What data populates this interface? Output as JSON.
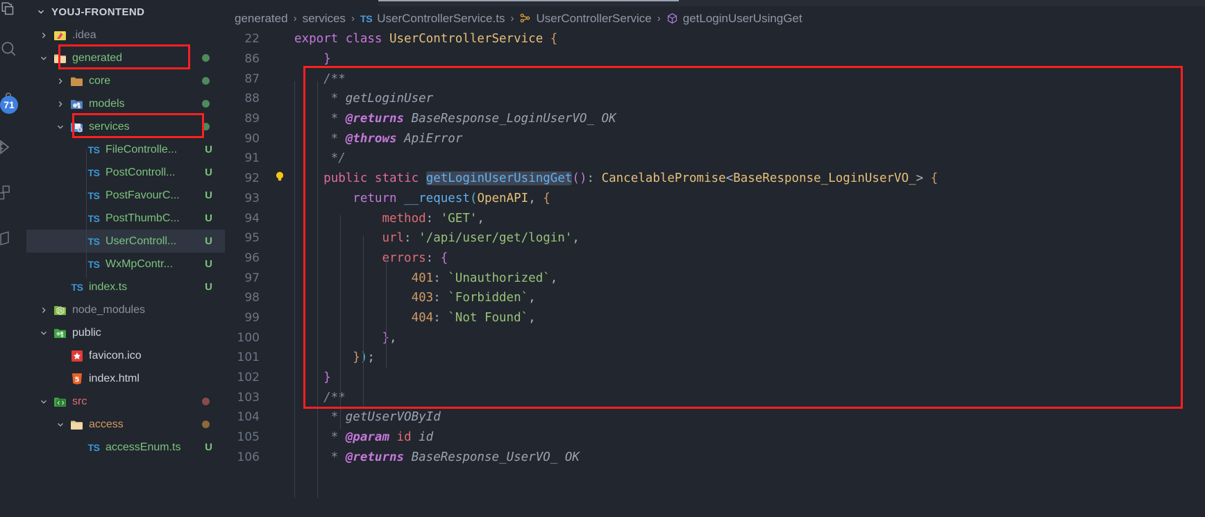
{
  "activity_bar": {
    "items": [
      {
        "name": "explorer-icon",
        "glyph": "files"
      },
      {
        "name": "search-icon",
        "glyph": "search"
      },
      {
        "name": "source-control-icon",
        "glyph": "branch"
      },
      {
        "name": "run-debug-icon",
        "glyph": "play"
      },
      {
        "name": "extensions-icon",
        "glyph": "squares"
      },
      {
        "name": "remote-icon",
        "glyph": "remote"
      }
    ],
    "badge_count": "71",
    "badge_color": "#3e7fe0"
  },
  "sidebar": {
    "title": "YOUJ-FRONTEND",
    "items": [
      {
        "label": ".idea",
        "depth": 1,
        "type": "folder-idea",
        "arrow": "right",
        "color": "#8a919e",
        "status": "",
        "status_color": ""
      },
      {
        "label": "generated",
        "depth": 1,
        "type": "folder-open",
        "arrow": "down",
        "color": "#7bc47f",
        "status": "dot",
        "status_color": "#4e8a5c",
        "highlight": true
      },
      {
        "label": "core",
        "depth": 2,
        "type": "folder",
        "arrow": "right",
        "color": "#7bc47f",
        "status": "dot",
        "status_color": "#4e8a5c"
      },
      {
        "label": "models",
        "depth": 2,
        "type": "folder-models",
        "arrow": "right",
        "color": "#7bc47f",
        "status": "dot",
        "status_color": "#4e8a5c"
      },
      {
        "label": "services",
        "depth": 2,
        "type": "folder-services",
        "arrow": "down",
        "color": "#7bc47f",
        "status": "dot",
        "status_color": "#4e8a5c",
        "highlight": true
      },
      {
        "label": "FileControlle...",
        "depth": 3,
        "type": "ts",
        "arrow": "none",
        "color": "#7bc47f",
        "status": "U",
        "status_color": "#7bc47f"
      },
      {
        "label": "PostControll...",
        "depth": 3,
        "type": "ts",
        "arrow": "none",
        "color": "#7bc47f",
        "status": "U",
        "status_color": "#7bc47f"
      },
      {
        "label": "PostFavourC...",
        "depth": 3,
        "type": "ts",
        "arrow": "none",
        "color": "#7bc47f",
        "status": "U",
        "status_color": "#7bc47f"
      },
      {
        "label": "PostThumbC...",
        "depth": 3,
        "type": "ts",
        "arrow": "none",
        "color": "#7bc47f",
        "status": "U",
        "status_color": "#7bc47f"
      },
      {
        "label": "UserControll...",
        "depth": 3,
        "type": "ts",
        "arrow": "none",
        "color": "#7bc47f",
        "status": "U",
        "status_color": "#7bc47f",
        "selected": true
      },
      {
        "label": "WxMpContr...",
        "depth": 3,
        "type": "ts",
        "arrow": "none",
        "color": "#7bc47f",
        "status": "U",
        "status_color": "#7bc47f"
      },
      {
        "label": "index.ts",
        "depth": 2,
        "type": "ts",
        "arrow": "none",
        "color": "#7bc47f",
        "status": "U",
        "status_color": "#7bc47f"
      },
      {
        "label": "node_modules",
        "depth": 1,
        "type": "folder-node",
        "arrow": "right",
        "color": "#8a919e",
        "status": "",
        "status_color": ""
      },
      {
        "label": "public",
        "depth": 1,
        "type": "folder-public",
        "arrow": "down",
        "color": "#cdd3de",
        "status": "",
        "status_color": ""
      },
      {
        "label": "favicon.ico",
        "depth": 2,
        "type": "favicon",
        "arrow": "none",
        "color": "#cdd3de",
        "status": "",
        "status_color": ""
      },
      {
        "label": "index.html",
        "depth": 2,
        "type": "html",
        "arrow": "none",
        "color": "#cdd3de",
        "status": "",
        "status_color": ""
      },
      {
        "label": "src",
        "depth": 1,
        "type": "folder-src",
        "arrow": "down",
        "color": "#e06c75",
        "status": "dot",
        "status_color": "#8a4a4a"
      },
      {
        "label": "access",
        "depth": 2,
        "type": "folder-open",
        "arrow": "down",
        "color": "#d19a66",
        "status": "dot",
        "status_color": "#8a6a3a"
      },
      {
        "label": "accessEnum.ts",
        "depth": 3,
        "type": "ts",
        "arrow": "none",
        "color": "#7bc47f",
        "status": "U",
        "status_color": "#7bc47f"
      }
    ]
  },
  "breadcrumb": {
    "segments": [
      {
        "label": "generated",
        "icon": "none"
      },
      {
        "label": "services",
        "icon": "none"
      },
      {
        "label": "UserControllerService.ts",
        "icon": "ts-badge"
      },
      {
        "label": "UserControllerService",
        "icon": "class-icon"
      },
      {
        "label": "getLoginUserUsingGet",
        "icon": "method-icon"
      }
    ],
    "separator": "›"
  },
  "editor": {
    "active_tab_label": "",
    "lightbulb_line": "92",
    "selected_token": "getLoginUserUsingGet",
    "lines": [
      {
        "num": "22",
        "indent": 0,
        "tokens": [
          {
            "t": "export ",
            "c": "t-kw"
          },
          {
            "t": "class ",
            "c": "t-kw"
          },
          {
            "t": "UserControllerService ",
            "c": "t-cls"
          },
          {
            "t": "{",
            "c": "t-brkt1"
          }
        ]
      },
      {
        "num": "86",
        "indent": 1,
        "tokens": [
          {
            "t": "    ",
            "c": "t-def"
          },
          {
            "t": "}",
            "c": "t-brkt2"
          }
        ]
      },
      {
        "num": "87",
        "indent": 1,
        "tokens": [
          {
            "t": "    /**",
            "c": "t-cmt"
          }
        ]
      },
      {
        "num": "88",
        "indent": 1,
        "tokens": [
          {
            "t": "     * ",
            "c": "t-cmt"
          },
          {
            "t": "getLoginUser",
            "c": "t-cmt-id"
          }
        ]
      },
      {
        "num": "89",
        "indent": 1,
        "tokens": [
          {
            "t": "     * ",
            "c": "t-cmt"
          },
          {
            "t": "@returns",
            "c": "t-tag"
          },
          {
            "t": " BaseResponse_LoginUserVO_ OK",
            "c": "t-cmt-id"
          }
        ]
      },
      {
        "num": "90",
        "indent": 1,
        "tokens": [
          {
            "t": "     * ",
            "c": "t-cmt"
          },
          {
            "t": "@throws",
            "c": "t-tag"
          },
          {
            "t": " ApiError",
            "c": "t-cmt-id"
          }
        ]
      },
      {
        "num": "91",
        "indent": 1,
        "tokens": [
          {
            "t": "     */",
            "c": "t-cmt"
          }
        ]
      },
      {
        "num": "92",
        "indent": 1,
        "highlight_token": "getLoginUserUsingGet",
        "tokens": [
          {
            "t": "    ",
            "c": "t-def"
          },
          {
            "t": "public ",
            "c": "t-kw2"
          },
          {
            "t": "static ",
            "c": "t-kw2"
          },
          {
            "t": "getLoginUserUsingGet",
            "c": "t-fn",
            "sel": true
          },
          {
            "t": "(",
            "c": "t-brkt2"
          },
          {
            "t": ")",
            "c": "t-brkt2"
          },
          {
            "t": ": ",
            "c": "t-def"
          },
          {
            "t": "CancelablePromise",
            "c": "t-cls"
          },
          {
            "t": "<",
            "c": "t-def"
          },
          {
            "t": "BaseResponse_LoginUserVO_",
            "c": "t-cls"
          },
          {
            "t": "> ",
            "c": "t-def"
          },
          {
            "t": "{",
            "c": "t-brkt1"
          }
        ]
      },
      {
        "num": "93",
        "indent": 2,
        "tokens": [
          {
            "t": "        ",
            "c": "t-def"
          },
          {
            "t": "return ",
            "c": "t-kw"
          },
          {
            "t": "__request",
            "c": "t-fn"
          },
          {
            "t": "(",
            "c": "t-brkt3"
          },
          {
            "t": "OpenAPI",
            "c": "t-cls"
          },
          {
            "t": ", ",
            "c": "t-def"
          },
          {
            "t": "{",
            "c": "t-brkt1"
          }
        ]
      },
      {
        "num": "94",
        "indent": 3,
        "tokens": [
          {
            "t": "            ",
            "c": "t-def"
          },
          {
            "t": "method",
            "c": "t-prop"
          },
          {
            "t": ": ",
            "c": "t-def"
          },
          {
            "t": "'GET'",
            "c": "t-str"
          },
          {
            "t": ",",
            "c": "t-def"
          }
        ]
      },
      {
        "num": "95",
        "indent": 3,
        "tokens": [
          {
            "t": "            ",
            "c": "t-def"
          },
          {
            "t": "url",
            "c": "t-prop"
          },
          {
            "t": ": ",
            "c": "t-def"
          },
          {
            "t": "'/api/user/get/login'",
            "c": "t-str"
          },
          {
            "t": ",",
            "c": "t-def"
          }
        ]
      },
      {
        "num": "96",
        "indent": 3,
        "tokens": [
          {
            "t": "            ",
            "c": "t-def"
          },
          {
            "t": "errors",
            "c": "t-prop"
          },
          {
            "t": ": ",
            "c": "t-def"
          },
          {
            "t": "{",
            "c": "t-brkt2"
          }
        ]
      },
      {
        "num": "97",
        "indent": 4,
        "tokens": [
          {
            "t": "                ",
            "c": "t-def"
          },
          {
            "t": "401",
            "c": "t-num"
          },
          {
            "t": ": ",
            "c": "t-def"
          },
          {
            "t": "`Unauthorized`",
            "c": "t-str"
          },
          {
            "t": ",",
            "c": "t-def"
          }
        ]
      },
      {
        "num": "98",
        "indent": 4,
        "tokens": [
          {
            "t": "                ",
            "c": "t-def"
          },
          {
            "t": "403",
            "c": "t-num"
          },
          {
            "t": ": ",
            "c": "t-def"
          },
          {
            "t": "`Forbidden`",
            "c": "t-str"
          },
          {
            "t": ",",
            "c": "t-def"
          }
        ]
      },
      {
        "num": "99",
        "indent": 4,
        "tokens": [
          {
            "t": "                ",
            "c": "t-def"
          },
          {
            "t": "404",
            "c": "t-num"
          },
          {
            "t": ": ",
            "c": "t-def"
          },
          {
            "t": "`Not Found`",
            "c": "t-str"
          },
          {
            "t": ",",
            "c": "t-def"
          }
        ]
      },
      {
        "num": "100",
        "indent": 3,
        "tokens": [
          {
            "t": "            ",
            "c": "t-def"
          },
          {
            "t": "}",
            "c": "t-brkt2"
          },
          {
            "t": ",",
            "c": "t-def"
          }
        ]
      },
      {
        "num": "101",
        "indent": 2,
        "tokens": [
          {
            "t": "        ",
            "c": "t-def"
          },
          {
            "t": "}",
            "c": "t-brkt1"
          },
          {
            "t": ")",
            "c": "t-brkt3"
          },
          {
            "t": ";",
            "c": "t-def"
          }
        ]
      },
      {
        "num": "102",
        "indent": 1,
        "tokens": [
          {
            "t": "    ",
            "c": "t-def"
          },
          {
            "t": "}",
            "c": "t-brkt2"
          }
        ]
      },
      {
        "num": "103",
        "indent": 1,
        "tokens": [
          {
            "t": "    /**",
            "c": "t-cmt"
          }
        ]
      },
      {
        "num": "104",
        "indent": 1,
        "tokens": [
          {
            "t": "     * ",
            "c": "t-cmt"
          },
          {
            "t": "getUserVOById",
            "c": "t-cmt-id"
          }
        ]
      },
      {
        "num": "105",
        "indent": 1,
        "tokens": [
          {
            "t": "     * ",
            "c": "t-cmt"
          },
          {
            "t": "@param",
            "c": "t-tag"
          },
          {
            "t": " ",
            "c": "t-cmt"
          },
          {
            "t": "id",
            "c": "t-var"
          },
          {
            "t": " id",
            "c": "t-cmt-id"
          }
        ]
      },
      {
        "num": "106",
        "indent": 1,
        "tokens": [
          {
            "t": "     * ",
            "c": "t-cmt"
          },
          {
            "t": "@returns",
            "c": "t-tag"
          },
          {
            "t": " BaseResponse_UserVO_ OK",
            "c": "t-cmt-id"
          }
        ]
      }
    ]
  },
  "annotations": {
    "red_color": "#fc2020",
    "boxes": [
      "generated-folder-row",
      "services-folder-row",
      "code-block-92-102"
    ]
  }
}
